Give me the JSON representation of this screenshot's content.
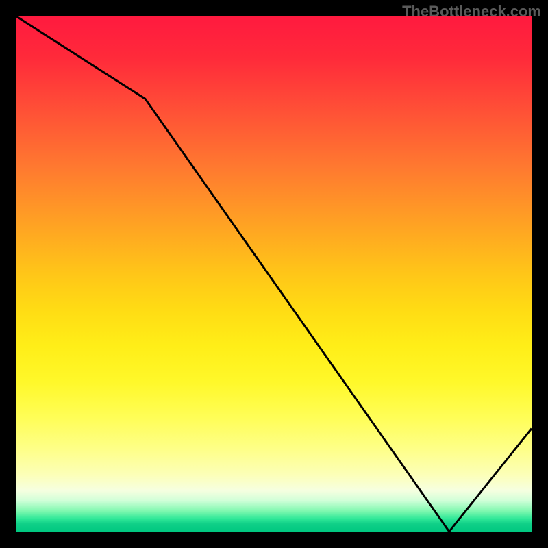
{
  "attribution": "TheBottleneck.com",
  "chart_data": {
    "type": "line",
    "x": [
      0,
      0.25,
      0.84,
      1.0
    ],
    "y": [
      100,
      84,
      0,
      20
    ],
    "title": "",
    "xlabel": "",
    "ylabel": "",
    "ylim": [
      0,
      100
    ],
    "xlim": [
      0,
      1
    ]
  }
}
